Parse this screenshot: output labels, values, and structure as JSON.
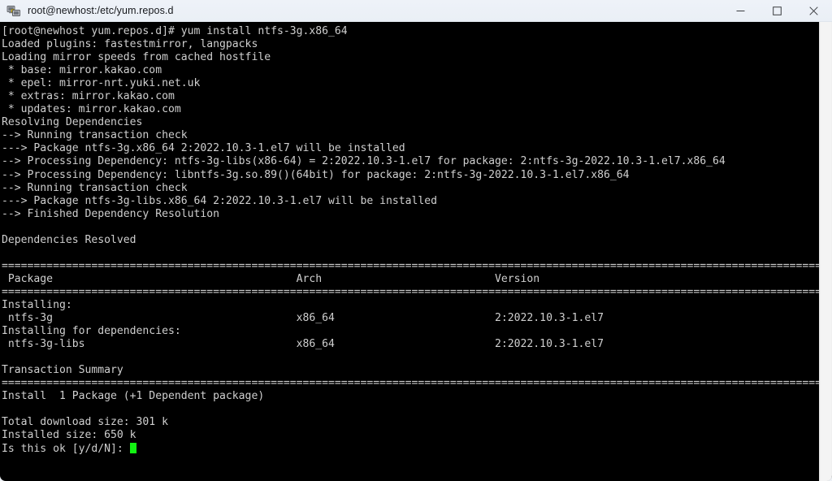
{
  "window": {
    "title": "root@newhost:/etc/yum.repos.d",
    "icon": "putty-terminal-icon",
    "controls": {
      "minimize_label": "─",
      "maximize_label": "□",
      "close_label": "✕",
      "minimize_name": "minimize-button",
      "maximize_name": "maximize-button",
      "close_name": "close-button"
    }
  },
  "terminal": {
    "background_color": "#000000",
    "foreground_color": "#cfcfcf",
    "cursor_color": "#12f312",
    "prompt": "[root@newhost yum.repos.d]#",
    "command": "yum install ntfs-3g.x86_64",
    "scrollbar": "vertical-scrollbar",
    "separator_char": "=",
    "lines": [
      "[root@newhost yum.repos.d]# yum install ntfs-3g.x86_64",
      "Loaded plugins: fastestmirror, langpacks",
      "Loading mirror speeds from cached hostfile",
      " * base: mirror.kakao.com",
      " * epel: mirror-nrt.yuki.net.uk",
      " * extras: mirror.kakao.com",
      " * updates: mirror.kakao.com",
      "Resolving Dependencies",
      "--> Running transaction check",
      "---> Package ntfs-3g.x86_64 2:2022.10.3-1.el7 will be installed",
      "--> Processing Dependency: ntfs-3g-libs(x86-64) = 2:2022.10.3-1.el7 for package: 2:ntfs-3g-2022.10.3-1.el7.x86_64",
      "--> Processing Dependency: libntfs-3g.so.89()(64bit) for package: 2:ntfs-3g-2022.10.3-1.el7.x86_64",
      "--> Running transaction check",
      "---> Package ntfs-3g-libs.x86_64 2:2022.10.3-1.el7 will be installed",
      "--> Finished Dependency Resolution",
      "",
      "Dependencies Resolved",
      "",
      "================================================================================================================================",
      " Package                                      Arch                           Version",
      "================================================================================================================================",
      "Installing:",
      " ntfs-3g                                      x86_64                         2:2022.10.3-1.el7",
      "Installing for dependencies:",
      " ntfs-3g-libs                                 x86_64                         2:2022.10.3-1.el7",
      "",
      "Transaction Summary",
      "================================================================================================================================",
      "Install  1 Package (+1 Dependent package)",
      "",
      "Total download size: 301 k",
      "Installed size: 650 k",
      "Is this ok [y/d/N]: "
    ],
    "table": {
      "headers": [
        "Package",
        "Arch",
        "Version"
      ],
      "sections": [
        {
          "label": "Installing:",
          "rows": [
            {
              "package": "ntfs-3g",
              "arch": "x86_64",
              "version": "2:2022.10.3-1.el7"
            }
          ]
        },
        {
          "label": "Installing for dependencies:",
          "rows": [
            {
              "package": "ntfs-3g-libs",
              "arch": "x86_64",
              "version": "2:2022.10.3-1.el7"
            }
          ]
        }
      ]
    },
    "summary": {
      "heading": "Transaction Summary",
      "install_line": "Install  1 Package (+1 Dependent package)",
      "total_download_size": "Total download size: 301 k",
      "installed_size": "Installed size: 650 k",
      "prompt_question": "Is this ok [y/d/N]: "
    }
  }
}
